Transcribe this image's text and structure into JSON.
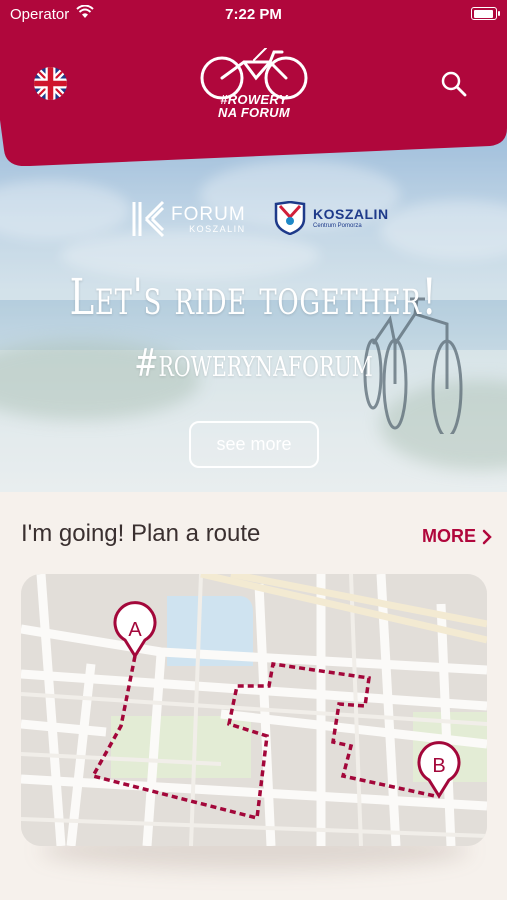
{
  "status_bar": {
    "carrier": "Operator",
    "time": "7:22 PM"
  },
  "header": {
    "logo_line1": "#ROWERY",
    "logo_line2": "NA FORUM",
    "language_icon": "uk-flag-icon",
    "search_icon": "search-icon"
  },
  "hero": {
    "partner1_name": "FORUM",
    "partner1_sub": "KOSZALIN",
    "partner2_name": "KOSZALIN",
    "partner2_sub": "Centrum Pomorza",
    "headline": "Let's ride together!",
    "hashtag": "#rowerynaforum",
    "cta_label": "see more"
  },
  "route_section": {
    "title": "I'm going! Plan a route",
    "more_label": "MORE",
    "marker_start": "A",
    "marker_end": "B"
  },
  "colors": {
    "brand": "#b0073c",
    "background": "#f6f1ec",
    "route": "#a3073a"
  }
}
